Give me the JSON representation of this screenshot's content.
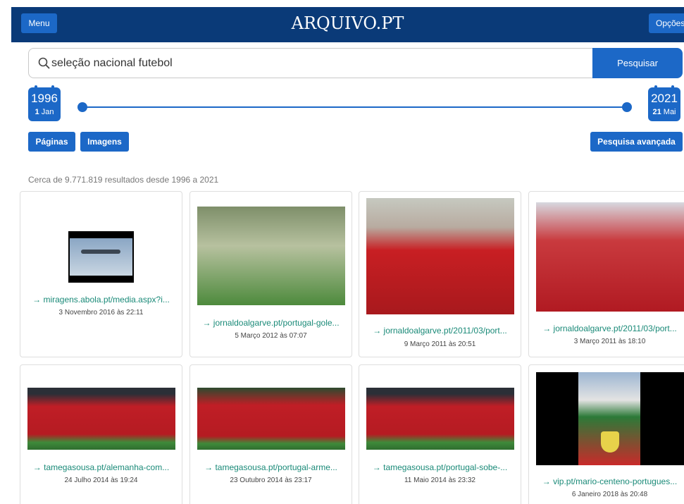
{
  "header": {
    "menu_label": "Menu",
    "logo": "ARQUIVO.PT",
    "options_label": "Opções"
  },
  "search": {
    "query": "seleção nacional futebol",
    "button_label": "Pesquisar",
    "icon": "search-icon"
  },
  "timeline": {
    "start": {
      "year": "1996",
      "day": "1",
      "month": "Jan"
    },
    "end": {
      "year": "2021",
      "day": "21",
      "month": "Mai"
    }
  },
  "type_buttons": {
    "pages": "Páginas",
    "images": "Imagens",
    "advanced": "Pesquisa avançada"
  },
  "results_count": "Cerca de 9.771.819 resultados desde 1996 a 2021",
  "results": [
    {
      "link": "→ miragens.abola.pt/media.aspx?i...",
      "date": "3 Novembro 2016 às 22:11"
    },
    {
      "link": "→ jornaldoalgarve.pt/portugal-gole...",
      "date": "5 Março 2012 às 07:07"
    },
    {
      "link": "→ jornaldoalgarve.pt/2011/03/port...",
      "date": "9 Março 2011 às 20:51"
    },
    {
      "link": "→ jornaldoalgarve.pt/2011/03/port...",
      "date": "3 Março 2011 às 18:10"
    },
    {
      "link": "→ tamegasousa.pt/alemanha-com...",
      "date": "24 Julho 2014 às 19:24"
    },
    {
      "link": "→ tamegasousa.pt/portugal-arme...",
      "date": "23 Outubro 2014 às 23:17"
    },
    {
      "link": "→ tamegasousa.pt/portugal-sobe-...",
      "date": "11 Maio 2014 às 23:32"
    },
    {
      "link": "→ vip.pt/mario-centeno-portugues...",
      "date": "6 Janeiro 2018 às 20:48"
    }
  ]
}
